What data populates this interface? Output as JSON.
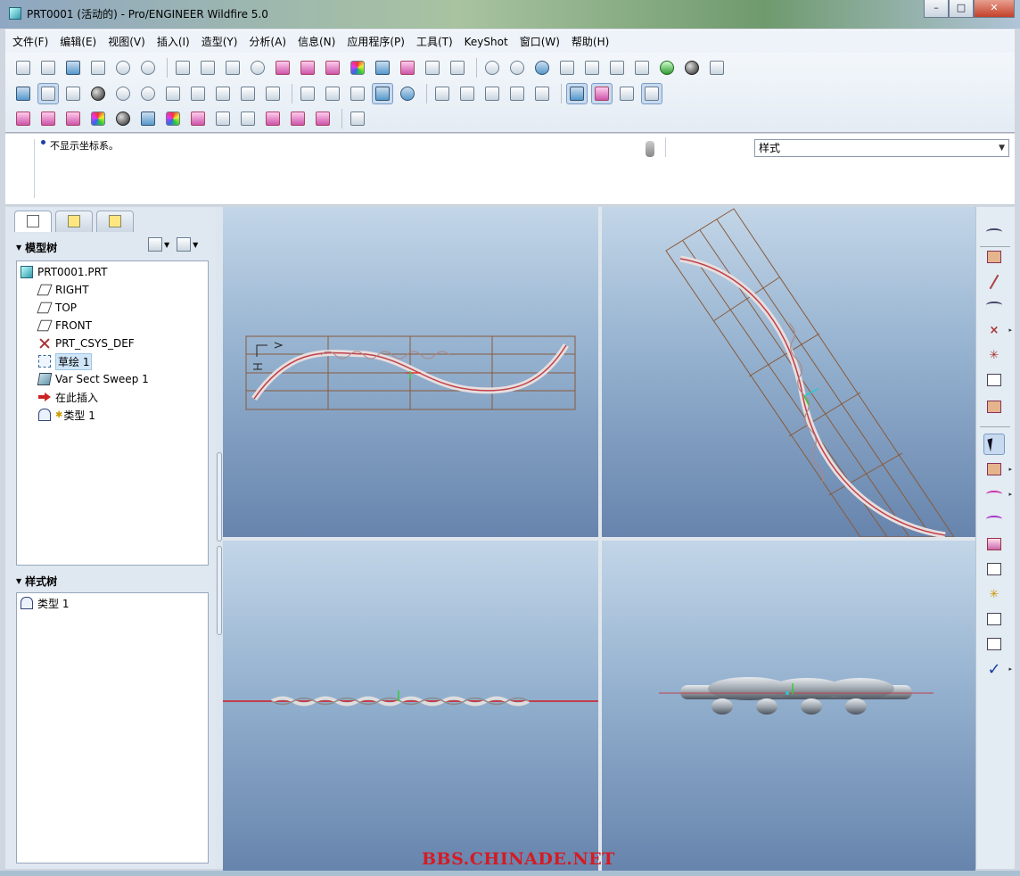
{
  "window": {
    "title": "PRT0001 (活动的) - Pro/ENGINEER Wildfire 5.0",
    "buttons": [
      "–",
      "□",
      "✕"
    ]
  },
  "menubar": {
    "items": [
      "文件(F)",
      "编辑(E)",
      "视图(V)",
      "插入(I)",
      "造型(Y)",
      "分析(A)",
      "信息(N)",
      "应用程序(P)",
      "工具(T)",
      "KeyShot",
      "窗口(W)",
      "帮助(H)"
    ]
  },
  "message": {
    "text": "不显示坐标系。"
  },
  "style_selector": {
    "value": "样式"
  },
  "model_tree": {
    "title": "模型树",
    "items": [
      {
        "label": "PRT0001.PRT",
        "icon": "part-icon"
      },
      {
        "label": "RIGHT",
        "icon": "datum-plane-icon"
      },
      {
        "label": "TOP",
        "icon": "datum-plane-icon"
      },
      {
        "label": "FRONT",
        "icon": "datum-plane-icon"
      },
      {
        "label": "PRT_CSYS_DEF",
        "icon": "csys-icon"
      },
      {
        "label": "草绘 1",
        "icon": "sketch-icon"
      },
      {
        "label": "Var Sect Sweep 1",
        "icon": "sweep-icon"
      },
      {
        "label": "在此插入",
        "icon": "insert-arrow-icon"
      },
      {
        "label": "类型 1",
        "icon": "style-feature-icon"
      }
    ]
  },
  "style_tree": {
    "title": "样式树",
    "items": [
      {
        "label": "类型 1",
        "icon": "style-feature-icon"
      }
    ]
  },
  "watermark": {
    "text": "BBS.CHINADE.NET"
  },
  "colors": {
    "viewport_top": "#c3d6e8",
    "viewport_bottom": "#6784ad",
    "datum_grid": "#8a5a3a",
    "curve_red": "#c0404a",
    "watermark_red": "#d51b24"
  }
}
